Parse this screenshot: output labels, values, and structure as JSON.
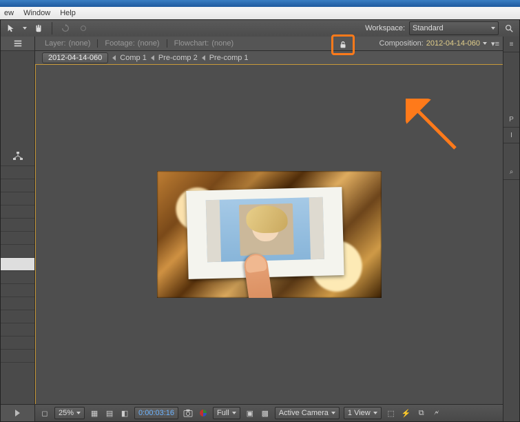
{
  "menu": {
    "view": "ew",
    "window": "Window",
    "help": "Help"
  },
  "workspace": {
    "label": "Workspace:",
    "value": "Standard"
  },
  "tabs": {
    "layer_prefix": "Layer:",
    "layer_value": "(none)",
    "footage_prefix": "Footage:",
    "footage_value": "(none)",
    "flowchart_prefix": "Flowchart:",
    "flowchart_value": "(none)",
    "comp_prefix": "Composition:",
    "comp_value": "2012-04-14-060"
  },
  "breadcrumb": {
    "root": "2012-04-14-060",
    "a": "Comp 1",
    "b": "Pre-comp 2",
    "c": "Pre-comp 1"
  },
  "status": {
    "zoom": "25%",
    "timecode": "0:00:03:16",
    "quality": "Full",
    "camera": "Active Camera",
    "views": "1 View"
  },
  "icons": {
    "square": "◻",
    "half": "◧"
  },
  "right": {
    "p": "P",
    "i": "I",
    "mag": "⌕"
  }
}
